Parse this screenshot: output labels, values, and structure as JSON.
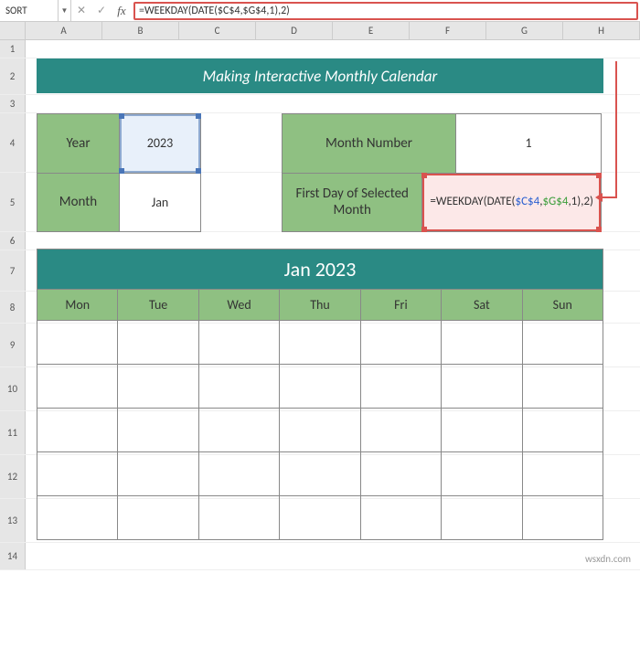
{
  "name_box": "SORT",
  "formula_bar": "=WEEKDAY(DATE($C$4,$G$4,1),2)",
  "columns": [
    "A",
    "B",
    "C",
    "D",
    "E",
    "F",
    "G",
    "H"
  ],
  "rows": [
    "1",
    "2",
    "3",
    "4",
    "5",
    "6",
    "7",
    "8",
    "9",
    "10",
    "11",
    "12",
    "13",
    "14"
  ],
  "title": "Making Interactive Monthly Calendar",
  "controls_left": {
    "year_label": "Year",
    "year_value": "2023",
    "month_label": "Month",
    "month_value": "Jan"
  },
  "controls_right": {
    "mn_label": "Month Number",
    "mn_value": "1",
    "fd_label": "First Day of Selected Month",
    "formula_prefix": "=WEEKDAY(DATE(",
    "formula_ref1": "$C$4",
    "formula_comma1": ",",
    "formula_ref2": "$G$4",
    "formula_suffix": ",1),2)"
  },
  "calendar": {
    "title": "Jan 2023",
    "days": [
      "Mon",
      "Tue",
      "Wed",
      "Thu",
      "Fri",
      "Sat",
      "Sun"
    ]
  },
  "watermark": "wsxdn.com"
}
